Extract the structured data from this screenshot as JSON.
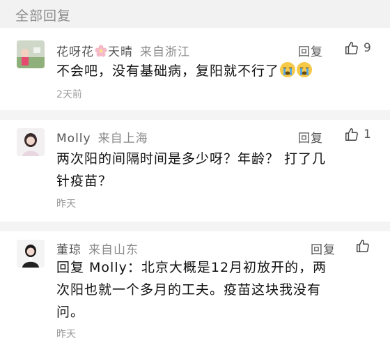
{
  "section_title": "全部回复",
  "reply_label": "回复",
  "comments": [
    {
      "name": "花呀花",
      "name_suffix": "天晴",
      "location": "来自浙江",
      "text": "不会吧，没有基础病，复阳就不行了",
      "time": "2天前",
      "likes": "9"
    },
    {
      "name": "Molly",
      "location": "来自上海",
      "text_lines": [
        "两次阳的间隔时间是多少呀？年龄？ 打了几",
        "针疫苗？"
      ],
      "time": "昨天",
      "likes": "1"
    },
    {
      "name": "董琼",
      "location": "来自山东",
      "text_lines": [
        "回复 Molly：北京大概是12月初放开的，两",
        "次阳也就一个多月的工夫。疫苗这块我没有",
        "问。"
      ],
      "time": "昨天",
      "likes": ""
    }
  ],
  "icons": {
    "like": "thumbs-up-icon",
    "crying_emoji": "crying-face-emoji",
    "flower": "flower-icon"
  }
}
